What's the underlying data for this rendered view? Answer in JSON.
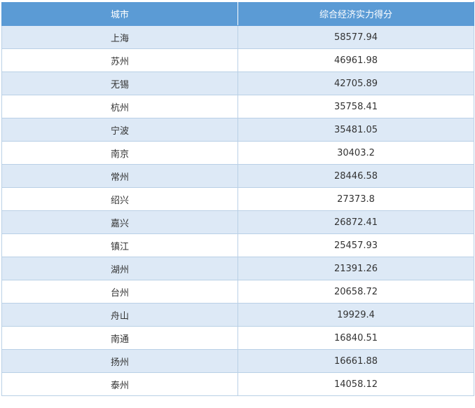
{
  "chart_data": {
    "type": "table",
    "columns": [
      "城市",
      "综合经济实力得分"
    ],
    "rows": [
      [
        "上海",
        "58577.94"
      ],
      [
        "苏州",
        "46961.98"
      ],
      [
        "无锡",
        "42705.89"
      ],
      [
        "杭州",
        "35758.41"
      ],
      [
        "宁波",
        "35481.05"
      ],
      [
        "南京",
        "30403.2"
      ],
      [
        "常州",
        "28446.58"
      ],
      [
        "绍兴",
        "27373.8"
      ],
      [
        "嘉兴",
        "26872.41"
      ],
      [
        "镇江",
        "25457.93"
      ],
      [
        "湖州",
        "21391.26"
      ],
      [
        "台州",
        "20658.72"
      ],
      [
        "舟山",
        "19929.4"
      ],
      [
        "南通",
        "16840.51"
      ],
      [
        "扬州",
        "16661.88"
      ],
      [
        "泰州",
        "14058.12"
      ]
    ]
  },
  "colors": {
    "header_bg": "#5b9bd5",
    "header_text": "#ffffff",
    "row_alt_bg": "#dde9f6",
    "row_bg": "#ffffff",
    "border": "#b9d0e6",
    "cell_text": "#333333"
  }
}
